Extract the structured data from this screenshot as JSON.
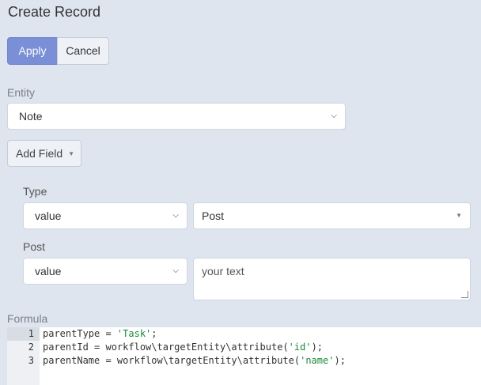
{
  "page": {
    "title": "Create Record"
  },
  "actions": {
    "apply_label": "Apply",
    "cancel_label": "Cancel"
  },
  "entity": {
    "label": "Entity",
    "value": "Note"
  },
  "add_field": {
    "label": "Add Field"
  },
  "fields": {
    "type": {
      "label": "Type",
      "mode": "value",
      "value": "Post"
    },
    "post": {
      "label": "Post",
      "mode": "value",
      "placeholder": "your text"
    }
  },
  "formula": {
    "label": "Formula",
    "lines": [
      {
        "num": "1",
        "pre": "parentType = ",
        "str": "'Task'",
        "post": ";"
      },
      {
        "num": "2",
        "pre": "parentId = workflow\\targetEntity\\attribute(",
        "str": "'id'",
        "post": ");"
      },
      {
        "num": "3",
        "pre": "parentName = workflow\\targetEntity\\attribute(",
        "str": "'name'",
        "post": ");"
      }
    ]
  },
  "colors": {
    "accent": "#7a8fd6",
    "background": "#dfe5ef",
    "string": "#1a8a3a"
  },
  "icons": {
    "select": "chevron-down-icon",
    "add_field": "caret-down-icon",
    "resize": "resize-grip-icon"
  }
}
